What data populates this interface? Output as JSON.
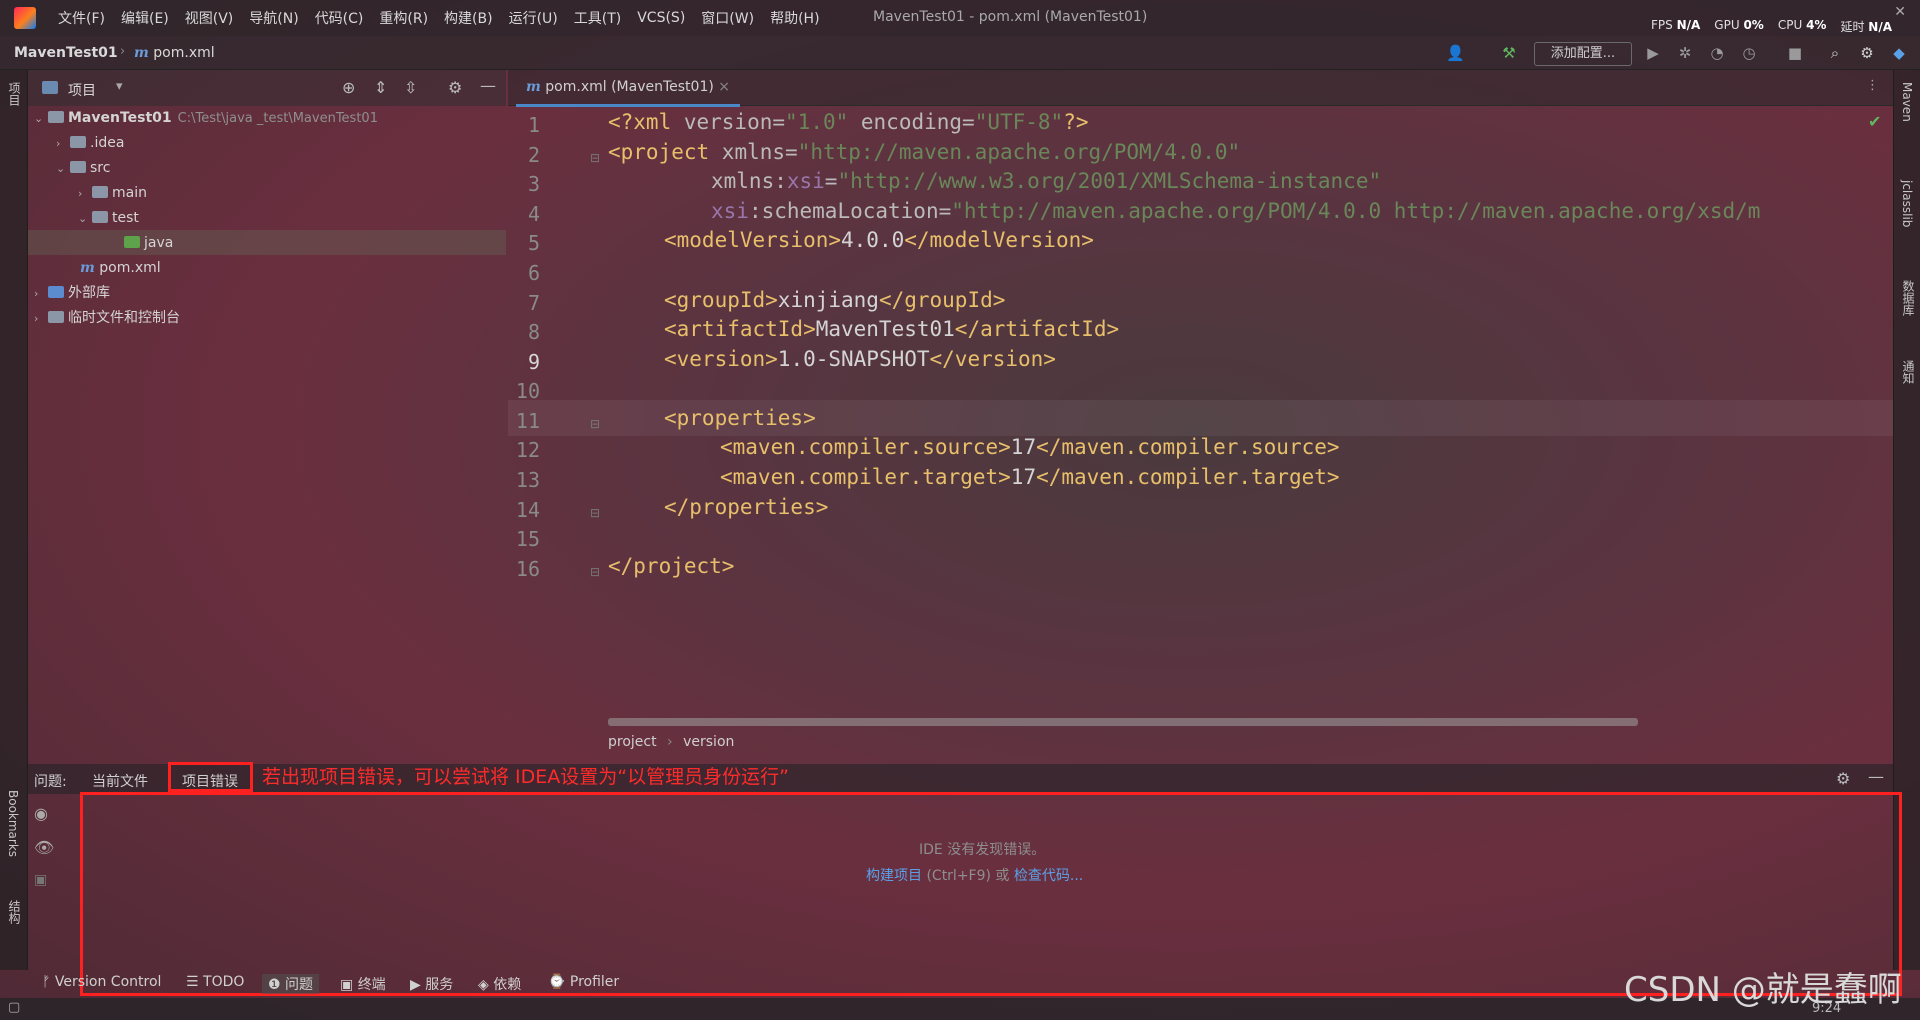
{
  "window": {
    "title": "MavenTest01 - pom.xml (MavenTest01)",
    "menu": [
      "文件(F)",
      "编辑(E)",
      "视图(V)",
      "导航(N)",
      "代码(C)",
      "重构(R)",
      "构建(B)",
      "运行(U)",
      "工具(T)",
      "VCS(S)",
      "窗口(W)",
      "帮助(H)"
    ],
    "perf": {
      "fps_label": "FPS",
      "fps": "N/A",
      "gpu_label": "GPU",
      "gpu": "0%",
      "cpu_label": "CPU",
      "cpu": "4%",
      "lat_label": "延时",
      "lat": "N/A"
    }
  },
  "navbar": {
    "project": "MavenTest01",
    "file": "pom.xml",
    "add_config": "添加配置..."
  },
  "left_stripe": {
    "project": "项目",
    "bookmarks": "Bookmarks",
    "structure": "结构"
  },
  "right_stripe": {
    "maven": "Maven",
    "jclasslib": "jclasslib",
    "database": "数据库",
    "notifications": "通知"
  },
  "project_panel": {
    "title": "项目",
    "tree": [
      {
        "label": "MavenTest01",
        "path": "C:\\Test\\java _test\\MavenTest01"
      },
      {
        "label": ".idea"
      },
      {
        "label": "src"
      },
      {
        "label": "main"
      },
      {
        "label": "test"
      },
      {
        "label": "java"
      },
      {
        "label": "pom.xml"
      },
      {
        "label": "外部库"
      },
      {
        "label": "临时文件和控制台"
      }
    ]
  },
  "editor": {
    "tab": "pom.xml (MavenTest01)",
    "current_line": 9,
    "lines": [
      "1",
      "2",
      "3",
      "4",
      "5",
      "6",
      "7",
      "8",
      "9",
      "10",
      "11",
      "12",
      "13",
      "14",
      "15",
      "16"
    ],
    "code": {
      "l1_open": "<?xml ",
      "l1_a1": "version",
      "l1_eq1": "=",
      "l1_v1": "\"1.0\"",
      "l1_a2": " encoding",
      "l1_eq2": "=",
      "l1_v2": "\"UTF-8\"",
      "l1_close": "?>",
      "l2_tag": "<project ",
      "l2_attr": "xmlns",
      "l2_eq": "=",
      "l2_val": "\"http://maven.apache.org/POM/4.0.0\"",
      "l3_attr": "xmlns:",
      "l3_ns": "xsi",
      "l3_eq": "=",
      "l3_val": "\"http://www.w3.org/2001/XMLSchema-instance\"",
      "l4_ns": "xsi",
      "l4_attr": ":schemaLocation",
      "l4_eq": "=",
      "l4_val": "\"http://maven.apache.org/POM/4.0.0 http://maven.apache.org/xsd/m",
      "l5_o": "<modelVersion>",
      "l5_t": "4.0.0",
      "l5_c": "</modelVersion>",
      "l7_o": "<groupId>",
      "l7_t": "xinjiang",
      "l7_c": "</groupId>",
      "l8_o": "<artifactId>",
      "l8_t": "MavenTest01",
      "l8_c": "</artifactId>",
      "l9_o": "<version>",
      "l9_t": "1.0-SNAPSHOT",
      "l9_c": "</version>",
      "l11": "<properties>",
      "l12_o": "<maven.compiler.source>",
      "l12_t": "17",
      "l12_c": "</maven.compiler.source>",
      "l13_o": "<maven.compiler.target>",
      "l13_t": "17",
      "l13_c": "</maven.compiler.target>",
      "l14": "</properties>",
      "l16": "</project>"
    },
    "breadcrumbs": [
      "project",
      "version"
    ]
  },
  "problems": {
    "label": "问题:",
    "tabs": [
      "当前文件",
      "项目错误"
    ],
    "annotation": "若出现项目错误，可以尝试将 IDEA设置为“以管理员身份运行”",
    "empty_msg": "IDE 没有发现错误。",
    "build_link": "构建项目",
    "build_shortcut": " (Ctrl+F9) 或 ",
    "inspect_link": "检查代码..."
  },
  "bottom_tabs": [
    "Version Control",
    "TODO",
    "问题",
    "终端",
    "服务",
    "依赖",
    "Profiler"
  ],
  "status": {
    "time": "9:24"
  },
  "watermark": "CSDN @就是蠢啊"
}
